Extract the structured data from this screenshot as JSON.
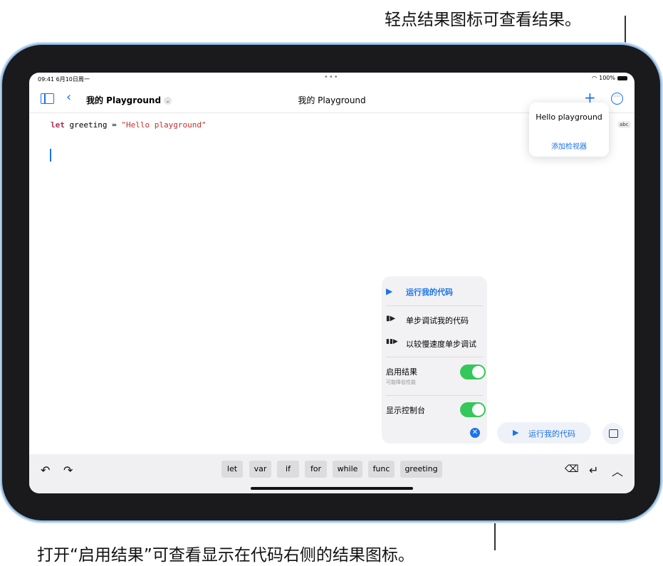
{
  "annotations": {
    "top": "轻点结果图标可查看结果。",
    "bottom": "打开“启用结果”可查看显示在代码右侧的结果图标。"
  },
  "status_bar": {
    "time": "09:41",
    "date": "6月10日周一",
    "battery": "100%"
  },
  "nav": {
    "doc_name": "我的 Playground",
    "title": "我的 Playground"
  },
  "code": {
    "keyword": "let",
    "identifier": "greeting",
    "operator": "=",
    "string": "\"Hello playground\""
  },
  "result_popover": {
    "value": "Hello playground",
    "add_viewer": "添加检视器",
    "badge": "abc"
  },
  "run_menu": {
    "run": "运行我的代码",
    "step": "单步调试我的代码",
    "step_slow": "以较慢速度单步调试",
    "enable_results": "启用结果",
    "enable_results_note": "可能降低性能",
    "show_console": "显示控制台",
    "enable_results_on": true,
    "show_console_on": true
  },
  "run_button": "运行我的代码",
  "shortcut_bar": [
    "let",
    "var",
    "if",
    "for",
    "while",
    "func",
    "greeting"
  ],
  "colors": {
    "accent": "#1a73e8",
    "toggle_on": "#34c759",
    "keyword": "#a8305c",
    "string": "#c4302b"
  }
}
